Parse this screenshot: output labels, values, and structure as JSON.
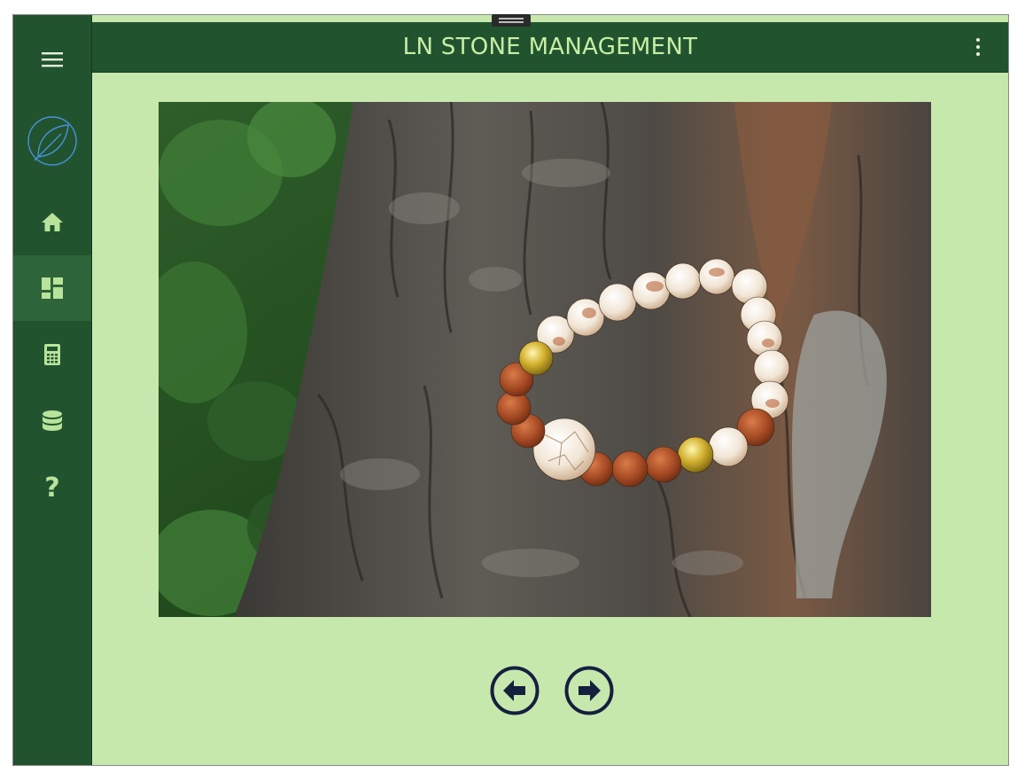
{
  "app": {
    "title": "LN STONE MANAGEMENT"
  },
  "sidebar": {
    "menu_icon": "hamburger-icon",
    "logo_icon": "leaf-logo-icon",
    "items": [
      {
        "id": "home",
        "icon": "home-icon",
        "active": false
      },
      {
        "id": "dashboard",
        "icon": "dashboard-icon",
        "active": true
      },
      {
        "id": "calculator",
        "icon": "calculator-icon",
        "active": false
      },
      {
        "id": "database",
        "icon": "database-icon",
        "active": false
      },
      {
        "id": "help",
        "icon": "question-mark-icon",
        "glyph": "?",
        "active": false
      }
    ]
  },
  "header": {
    "more_icon": "more-vertical-icon"
  },
  "gallery": {
    "image_subject": "bracelet-photo",
    "prev_icon": "arrow-left-circle-icon",
    "next_icon": "arrow-right-circle-icon"
  },
  "colors": {
    "sidebar_bg": "#21532f",
    "active_item_bg": "#2e6439",
    "content_bg": "#c7e8ad",
    "title_text": "#c7eea5",
    "icon_color": "#b8e39a",
    "arrow_color": "#15203f"
  }
}
